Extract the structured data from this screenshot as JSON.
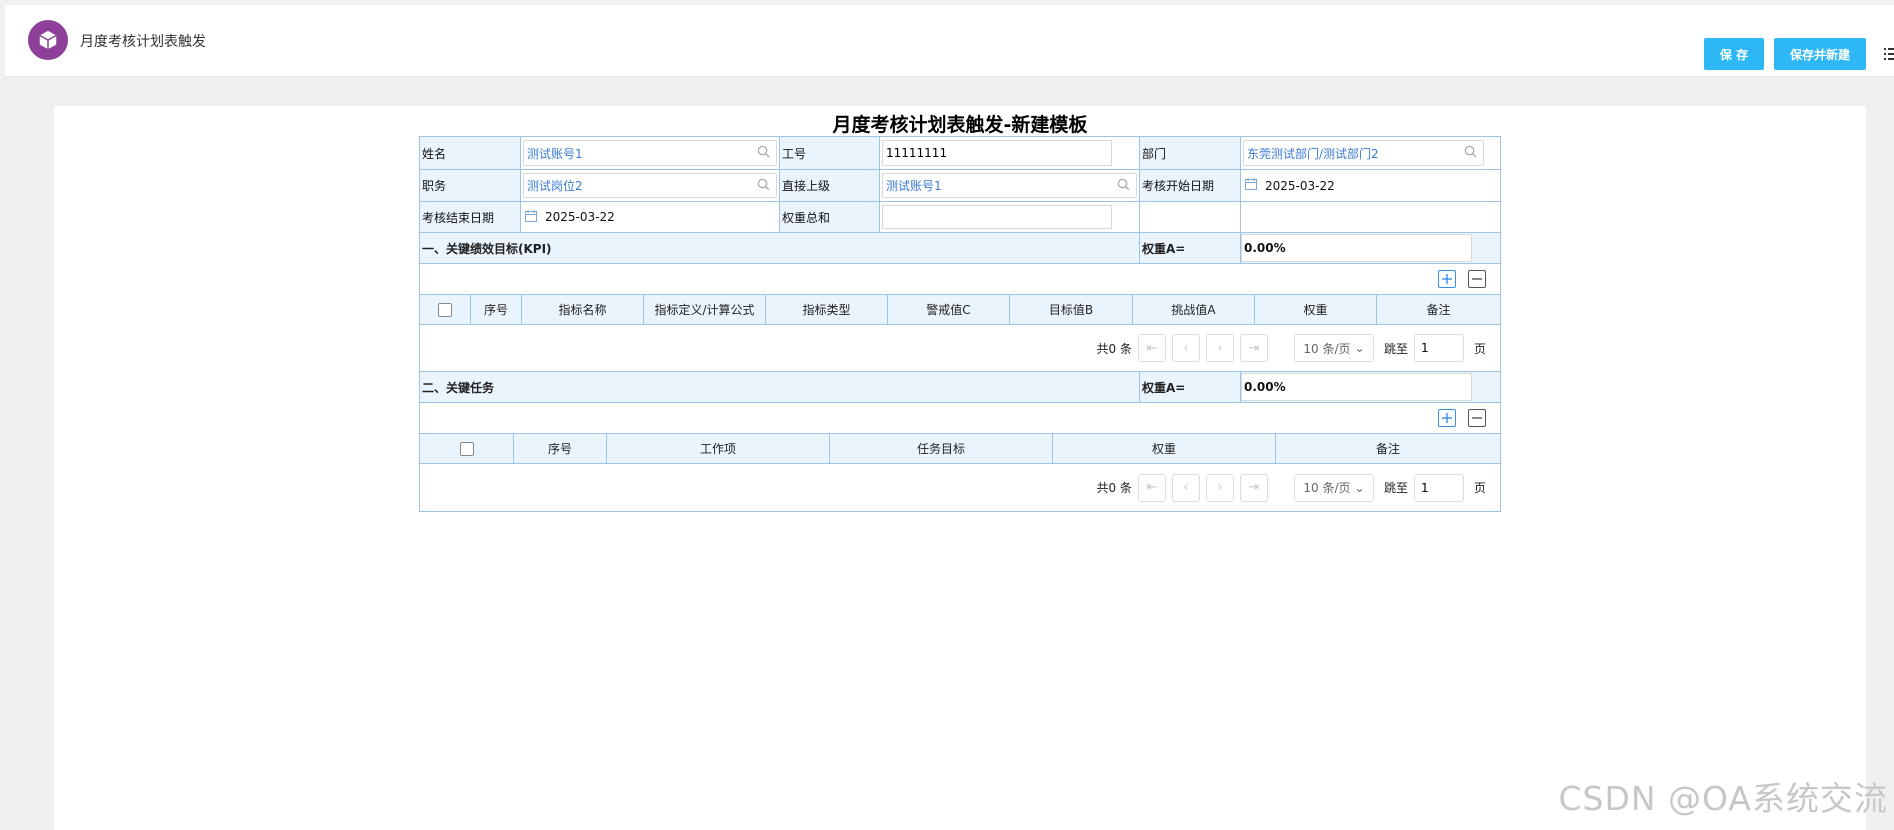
{
  "app": {
    "title": "月度考核计划表触发",
    "buttons": {
      "save": "保 存",
      "save_new": "保存并新建"
    }
  },
  "form": {
    "title": "月度考核计划表触发-新建模板",
    "fields": {
      "name_label": "姓名",
      "name_value": "测试账号1",
      "empno_label": "工号",
      "empno_value": "11111111",
      "dept_label": "部门",
      "dept_value": "东莞测试部门/测试部门2",
      "position_label": "职务",
      "position_value": "测试岗位2",
      "manager_label": "直接上级",
      "manager_value": "测试账号1",
      "start_label": "考核开始日期",
      "start_value": "2025-03-22",
      "end_label": "考核结束日期",
      "end_value": "2025-03-22",
      "weight_total_label": "权重总和",
      "weight_total_value": ""
    },
    "kpi": {
      "heading": "一、关键绩效目标(KPI)",
      "weight_label": "权重A=",
      "weight_value": "0.00%",
      "columns": [
        "序号",
        "指标名称",
        "指标定义/计算公式",
        "指标类型",
        "警戒值C",
        "目标值B",
        "挑战值A",
        "权重",
        "备注"
      ],
      "pager": {
        "total": "共0 条",
        "page_size": "10 条/页",
        "jump_label": "跳至",
        "page_value": "1",
        "page_unit": "页"
      }
    },
    "tasks": {
      "heading": "二、关键任务",
      "weight_label": "权重A=",
      "weight_value": "0.00%",
      "columns": [
        "序号",
        "工作项",
        "任务目标",
        "权重",
        "备注"
      ],
      "pager": {
        "total": "共0 条",
        "page_size": "10 条/页",
        "jump_label": "跳至",
        "page_value": "1",
        "page_unit": "页"
      }
    }
  },
  "watermark": "CSDN @OA系统交流",
  "colors": {
    "accent": "#2db7f5",
    "logo": "#8e3f97",
    "grid_border": "#9dc3e6",
    "label_bg": "#eaf4fd",
    "link": "#3a7bd5"
  }
}
